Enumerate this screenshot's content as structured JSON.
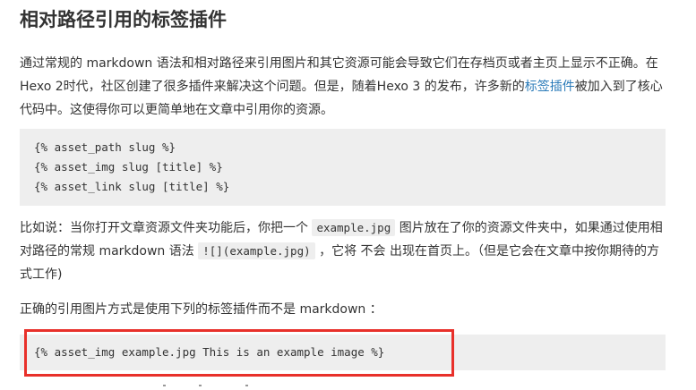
{
  "article": {
    "title": "相对路径引用的标签插件",
    "p1": {
      "before": "通过常规的 markdown 语法和相对路径来引用图片和其它资源可能会导致它们在存档页或者主页上显示不正确。在Hexo 2时代，社区创建了很多插件来解决这个问题。但是，随着Hexo 3 的发布，许多新的",
      "link": "标签插件",
      "after": "被加入到了核心代码中。这使得你可以更简单地在文章中引用你的资源。"
    },
    "code_block_1": {
      "lines": [
        "{% asset_path slug %}",
        "{% asset_img slug [title] %}",
        "{% asset_link slug [title] %}"
      ]
    },
    "p2": {
      "part1": "比如说：当你打开文章资源文件夹功能后，你把一个 ",
      "code1": "example.jpg",
      "part2": " 图片放在了你的资源文件夹中，如果通过使用相对路径的常规 markdown 语法 ",
      "code2": "![](example.jpg)",
      "part3": " ，它将 不会 出现在首页上。（但是它会在文章中按你期待的方式工作)"
    },
    "p3": {
      "text": "正确的引用图片方式是使用下列的标签插件而不是 markdown ："
    },
    "code_block_2": {
      "line": "{% asset_img example.jpg This is an example image %}"
    }
  },
  "colors": {
    "text": "#333333",
    "link": "#2b7bb9",
    "code_background": "#eeeeee",
    "highlight_border": "#e8302a"
  }
}
